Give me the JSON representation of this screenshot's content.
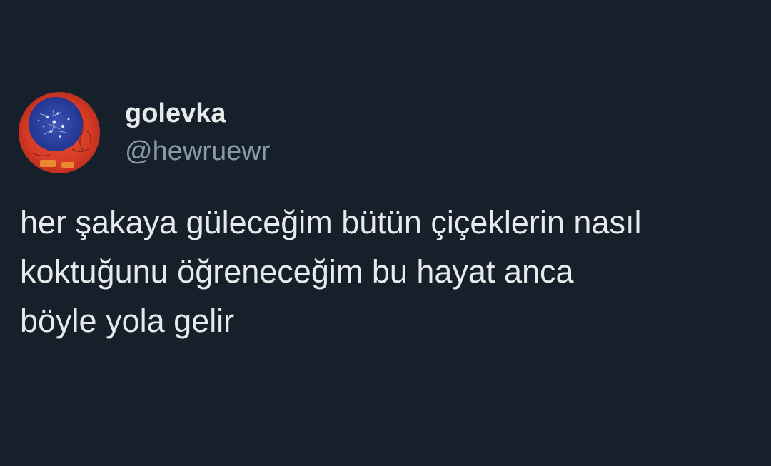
{
  "user": {
    "display_name": "golevka",
    "handle": "@hewruewr",
    "avatar_icon": "album-art-avatar"
  },
  "tweet": {
    "lines": [
      "her şakaya güleceğim bütün çiçeklerin nasıl",
      "koktuğunu öğreneceğim bu hayat anca",
      "böyle yola gelir"
    ]
  },
  "colors": {
    "background": "#15202b",
    "text_primary": "#e7e9ea",
    "text_secondary": "#8b98a5",
    "avatar_red": "#d43a2a",
    "avatar_blue": "#2c3f9c"
  }
}
